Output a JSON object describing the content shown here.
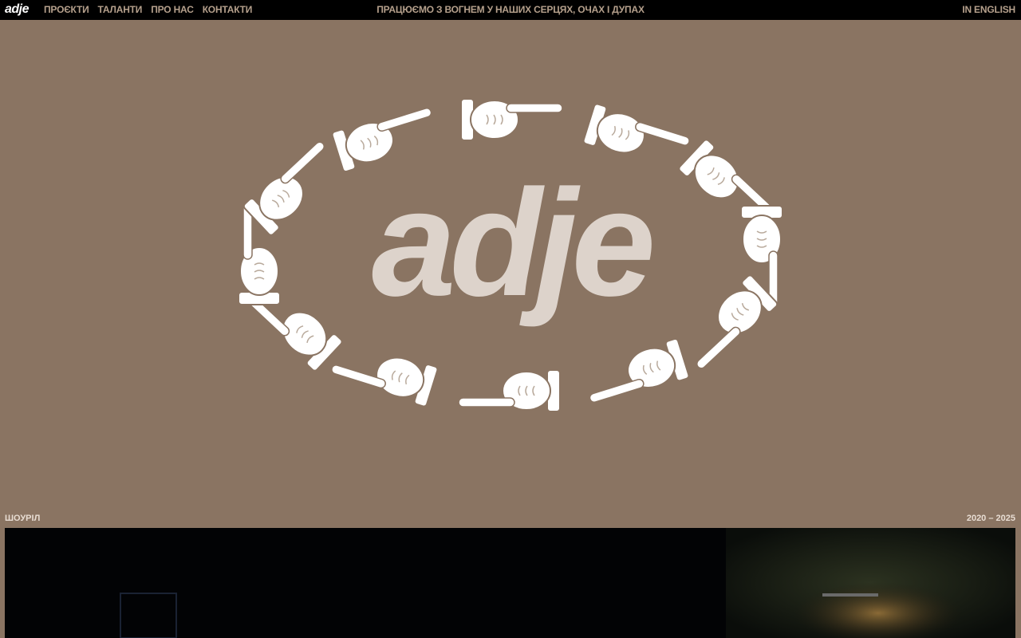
{
  "header": {
    "logo_text": "adje",
    "nav": [
      {
        "label": "ПРОЄКТИ"
      },
      {
        "label": "ТАЛАНТИ"
      },
      {
        "label": "ПРО НАС"
      },
      {
        "label": "КОНТАКТИ"
      }
    ],
    "tagline": "ПРАЦЮЄМО З ВОГНЕМ У НАШИХ СЕРЦЯХ, ОЧАХ І ДУПАХ",
    "language_link": "IN ENGLISH"
  },
  "hero": {
    "logo_word": "adje",
    "background_color": "#8a7462",
    "logo_color": "#ddd3cb",
    "hand_color": "#ffffff"
  },
  "showreel": {
    "label": "ШОУРІЛ",
    "years": "2020 – 2025"
  }
}
